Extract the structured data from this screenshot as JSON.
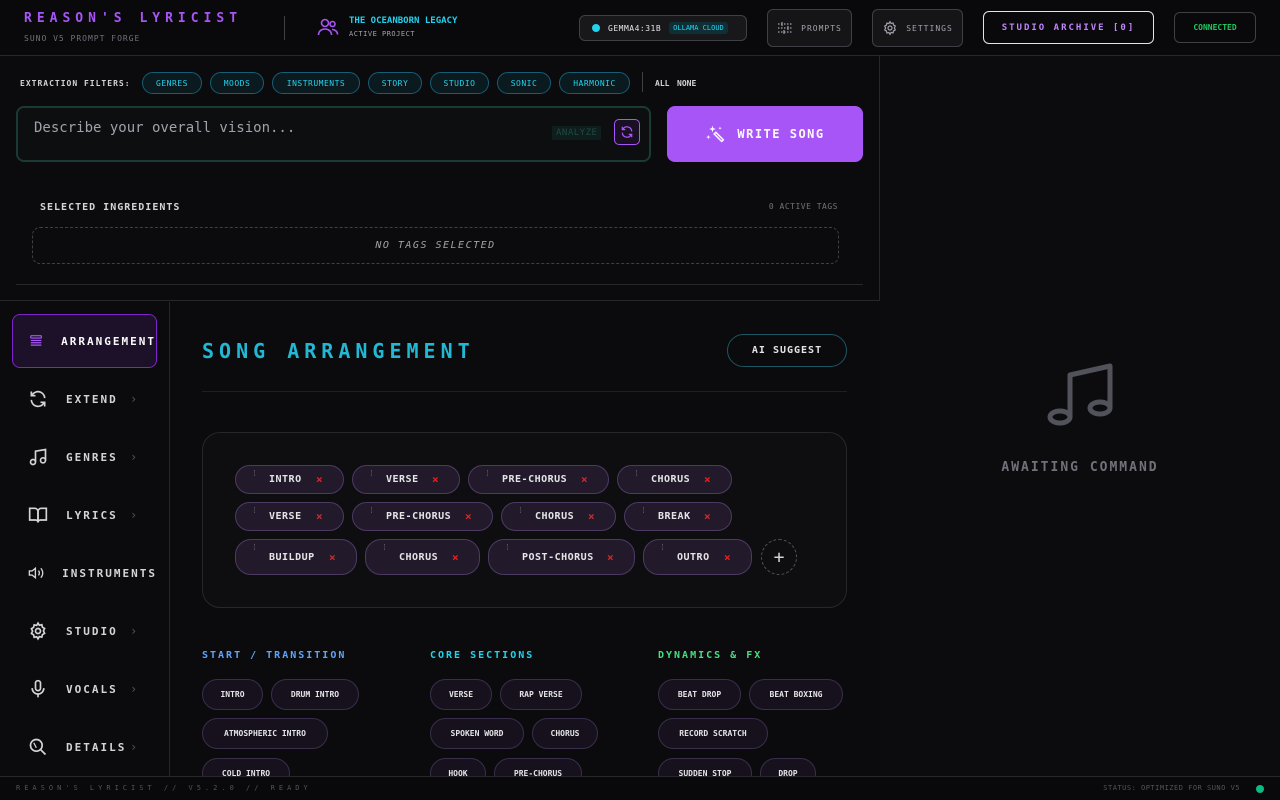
{
  "header": {
    "brand_title": "REASON'S LYRICIST",
    "brand_subtitle": "SUNO V5 PROMPT FORGE",
    "project_name": "THE OCEANBORN LEGACY",
    "project_subtitle": "ACTIVE PROJECT",
    "model_name": "GEMMA4:31B",
    "model_badge": "OLLAMA CLOUD",
    "prompts_label": "PROMPTS",
    "settings_label": "SETTINGS",
    "archive_label": "STUDIO ARCHIVE [0]",
    "connection_status": "CONNECTED"
  },
  "filters": {
    "label": "EXTRACTION FILTERS:",
    "chips": [
      "GENRES",
      "MOODS",
      "INSTRUMENTS",
      "STORY",
      "STUDIO",
      "SONIC",
      "HARMONIC"
    ],
    "all_label": "ALL",
    "none_label": "NONE"
  },
  "vision": {
    "placeholder": "Describe your overall vision...",
    "analyze_label": "ANALYZE",
    "write_label": "WRITE SONG"
  },
  "ingredients": {
    "title": "SELECTED INGREDIENTS",
    "count": "0 ACTIVE TAGS",
    "empty": "NO TAGS SELECTED"
  },
  "sidebar": {
    "items": [
      {
        "label": "ARRANGEMENT",
        "icon": "list-icon"
      },
      {
        "label": "EXTEND",
        "icon": "refresh-icon"
      },
      {
        "label": "GENRES",
        "icon": "music-note-icon"
      },
      {
        "label": "LYRICS",
        "icon": "book-icon"
      },
      {
        "label": "INSTRUMENTS",
        "icon": "speaker-icon"
      },
      {
        "label": "STUDIO",
        "icon": "gear-icon"
      },
      {
        "label": "VOCALS",
        "icon": "microphone-icon"
      },
      {
        "label": "DETAILS",
        "icon": "magnifier-icon"
      }
    ]
  },
  "arrangement": {
    "title": "SONG ARRANGEMENT",
    "ai_suggest_label": "AI SUGGEST",
    "sequence": [
      "INTRO",
      "VERSE",
      "PRE-CHORUS",
      "CHORUS",
      "VERSE",
      "PRE-CHORUS",
      "CHORUS",
      "BREAK",
      "BUILDUP",
      "CHORUS",
      "POST-CHORUS",
      "OUTRO"
    ],
    "remove_glyph": "×",
    "add_glyph": "+"
  },
  "palette": {
    "start_title": "START / TRANSITION",
    "start": [
      "INTRO",
      "DRUM INTRO",
      "ATMOSPHERIC INTRO",
      "COLD INTRO"
    ],
    "core_title": "CORE SECTIONS",
    "core": [
      "VERSE",
      "RAP VERSE",
      "SPOKEN WORD",
      "CHORUS",
      "HOOK",
      "PRE-CHORUS"
    ],
    "dynamics_title": "DYNAMICS & FX",
    "dynamics": [
      "BEAT DROP",
      "BEAT BOXING",
      "RECORD SCRATCH",
      "SUDDEN STOP",
      "DROP"
    ]
  },
  "right_panel": {
    "status": "AWAITING COMMAND"
  },
  "footer": {
    "left": "REASON'S LYRICIST // V5.2.0 // READY",
    "right": "STATUS: OPTIMIZED FOR SUNO V5"
  },
  "colors": {
    "accent_purple": "#a855f7",
    "accent_cyan": "#22d3ee",
    "status_green": "#22c55e",
    "remove_red": "#dc2626"
  }
}
